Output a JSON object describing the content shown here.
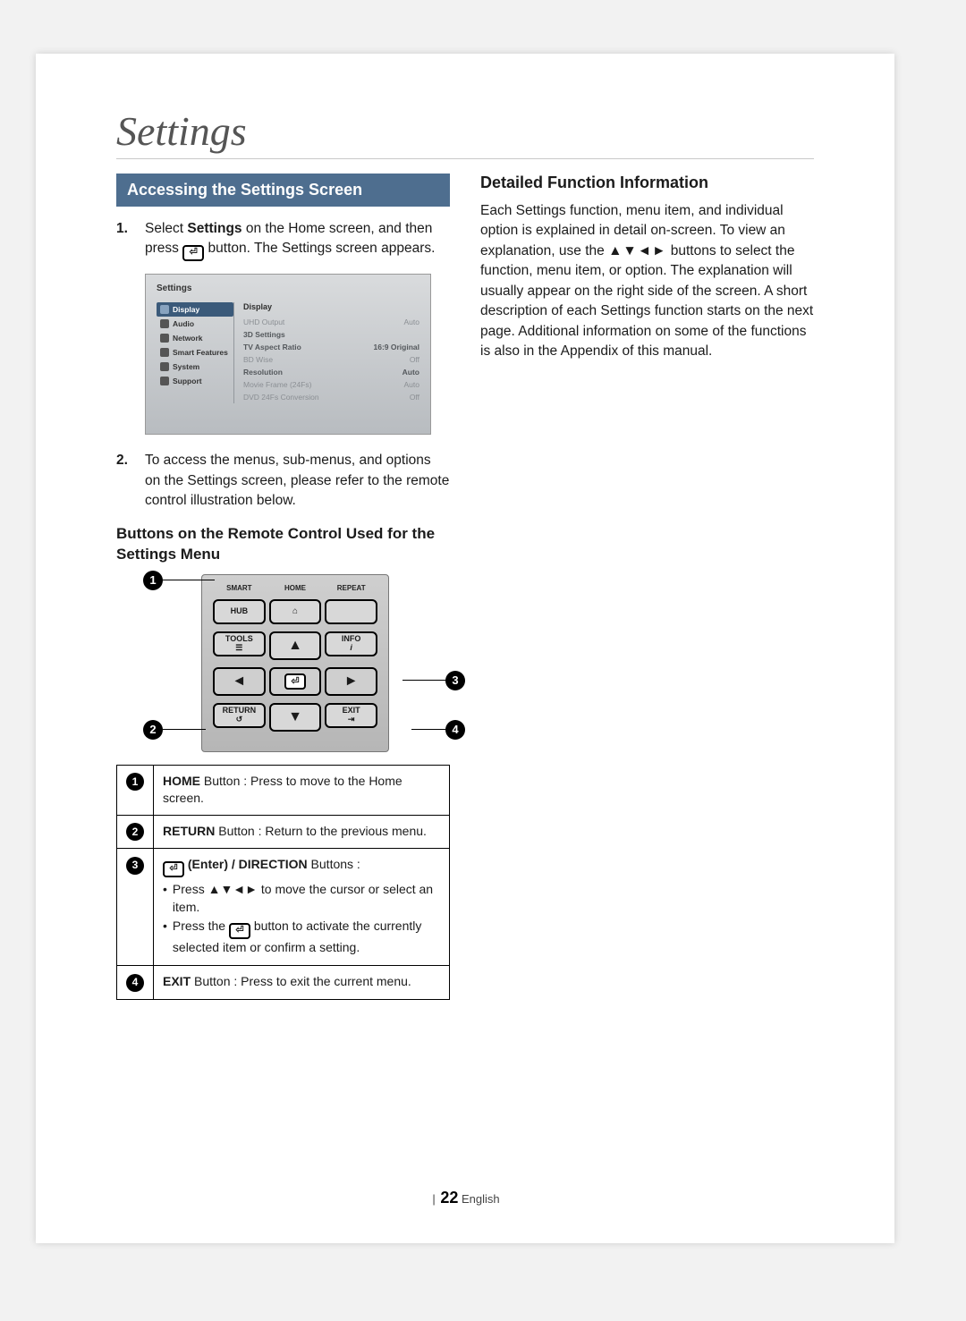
{
  "page": {
    "title": "Settings",
    "number": "22",
    "lang": "English"
  },
  "left": {
    "sectionHeader": "Accessing the Settings Screen",
    "step1_prefix": "Select ",
    "step1_bold": "Settings",
    "step1_mid": " on the Home screen, and then press ",
    "step1_suffix": " button. The Settings screen appears.",
    "step2": "To access the menus, sub-menus, and options on the Settings screen, please refer to the remote control illustration below.",
    "subHeader": "Buttons on the Remote Control Used for the Settings Menu"
  },
  "screenshot": {
    "title": "Settings",
    "side": [
      "Display",
      "Audio",
      "Network",
      "Smart Features",
      "System",
      "Support"
    ],
    "panelTitle": "Display",
    "rows": [
      {
        "label": "UHD Output",
        "value": "Auto"
      },
      {
        "label": "3D Settings",
        "value": ""
      },
      {
        "label": "TV Aspect Ratio",
        "value": "16:9 Original"
      },
      {
        "label": "BD Wise",
        "value": "Off"
      },
      {
        "label": "Resolution",
        "value": "Auto"
      },
      {
        "label": "Movie Frame (24Fs)",
        "value": "Auto"
      },
      {
        "label": "DVD 24Fs Conversion",
        "value": "Off"
      }
    ]
  },
  "remote": {
    "topLabels": [
      "SMART",
      "HOME",
      "REPEAT"
    ],
    "hub": "HUB",
    "tools": "TOOLS",
    "info": "INFO",
    "return": "RETURN",
    "exit": "EXIT"
  },
  "table": {
    "r1_bold": "HOME",
    "r1_rest": " Button : Press to move to the Home screen.",
    "r2_bold": "RETURN",
    "r2_rest": " Button : Return to the previous menu.",
    "r3_bold": " (Enter) / DIRECTION",
    "r3_rest": " Buttons :",
    "r3_b1": "Press ▲▼◄► to move the cursor or select an item.",
    "r3_b2a": "Press the ",
    "r3_b2b": " button to activate the currently selected item or confirm a setting.",
    "r4_bold": "EXIT",
    "r4_rest": " Button : Press to exit the current menu."
  },
  "right": {
    "header": "Detailed Function Information",
    "body_a": "Each Settings function, menu item, and individual option is explained in detail on-screen. To view an explanation, use the ",
    "arrows": "▲▼◄►",
    "body_b": " buttons to select the function, menu item, or option. The explanation will usually appear on the right side of the screen. A short description of each Settings function starts on the next page. Additional information on some of the functions is also in the Appendix of this manual."
  }
}
